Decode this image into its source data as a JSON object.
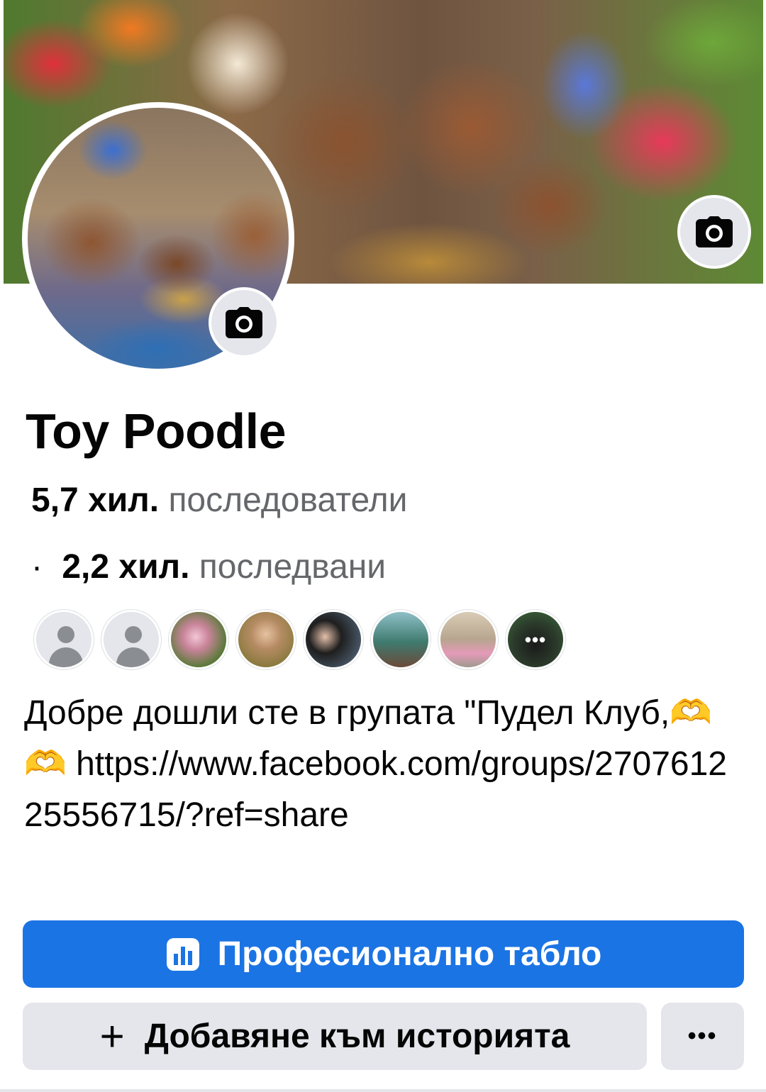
{
  "profile": {
    "name": "Toy Poodle",
    "followers_count": "5,7 хил.",
    "followers_label": "последователи",
    "following_count": "2,2 хил.",
    "following_label": "последвани",
    "bio": "Добре дошли сте в групата \"Пудел Клуб,🫶🫶 https://www.facebook.com/groups/270761225556715/?ref=share"
  },
  "follower_avatars": [
    {
      "type": "default"
    },
    {
      "type": "default"
    },
    {
      "type": "photo",
      "color": "#5b7a3a"
    },
    {
      "type": "photo",
      "color": "#8a7a3e"
    },
    {
      "type": "photo",
      "color": "#4a5a6a"
    },
    {
      "type": "photo",
      "color": "#3f7a6e"
    },
    {
      "type": "photo",
      "color": "#b7a58f"
    },
    {
      "type": "more",
      "color": "#2b3a2b",
      "label": "•••"
    }
  ],
  "actions": {
    "primary_label": "Професионално табло",
    "primary_icon": "dashboard-icon",
    "secondary_label": "Добавяне към историята",
    "secondary_icon": "plus-icon",
    "more_label": "•••"
  },
  "icons": {
    "cover_camera": "camera-icon",
    "avatar_camera": "camera-icon"
  },
  "colors": {
    "brand_blue": "#1b74e4",
    "secondary_button": "#e4e6eb",
    "muted_text": "#65676b"
  }
}
